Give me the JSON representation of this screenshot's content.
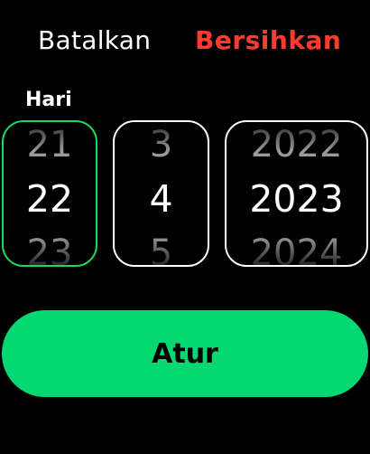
{
  "header": {
    "cancel_label": "Batalkan",
    "clear_label": "Bersihkan"
  },
  "picker": {
    "focused_column_label": "Hari",
    "day": {
      "prev": "21",
      "value": "22",
      "next": "23"
    },
    "month": {
      "prev": "3",
      "value": "4",
      "next": "5"
    },
    "year": {
      "prev": "2022",
      "value": "2023",
      "next": "2024"
    }
  },
  "actions": {
    "set_label": "Atur"
  },
  "colors": {
    "background": "#000000",
    "destructive": "#ff3b30",
    "accent": "#05d873",
    "focus_ring": "#1ed760"
  }
}
